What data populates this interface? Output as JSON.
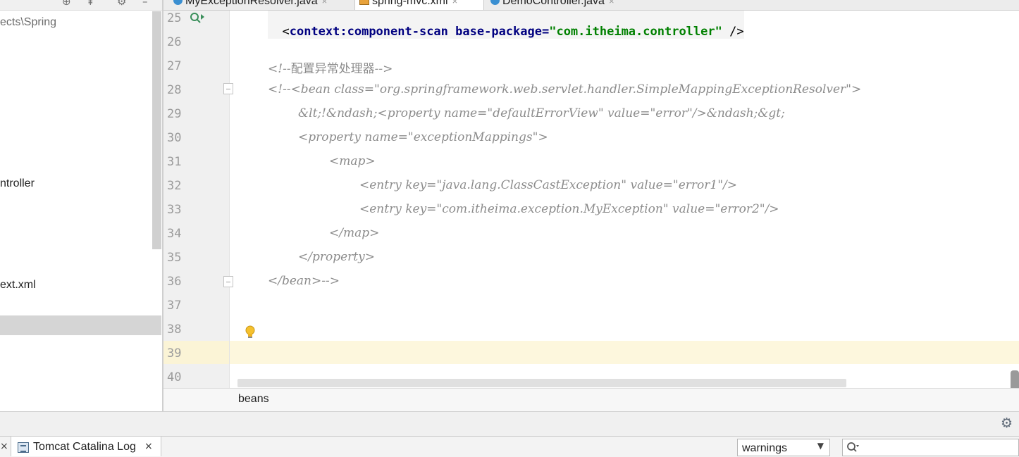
{
  "project": {
    "items": [
      {
        "label": "ects\\Spring"
      },
      {
        "label": "ntroller"
      },
      {
        "label": "ext.xml"
      }
    ]
  },
  "tabs": [
    {
      "label": "MyExceptionResolver.java",
      "icon": "class-c-icon"
    },
    {
      "label": "spring-mvc.xml",
      "icon": "xml-file-icon",
      "active": true
    },
    {
      "label": "DemoController.java",
      "icon": "class-c-icon"
    }
  ],
  "editor": {
    "lines": [
      {
        "num": "25",
        "text": "<context:component-scan base-package=\"com.itheima.controller\"/>"
      },
      {
        "num": "26",
        "text": ""
      },
      {
        "num": "27",
        "text": "<!--配置异常处理器-->"
      },
      {
        "num": "28",
        "text": "<!--<bean class=\"org.springframework.web.servlet.handler.SimpleMappingExceptionResolver\">"
      },
      {
        "num": "29",
        "text": "&lt;!&ndash;<property name=\"defaultErrorView\" value=\"error\"/>&ndash;&gt;"
      },
      {
        "num": "30",
        "text": "<property name=\"exceptionMappings\">"
      },
      {
        "num": "31",
        "text": "<map>"
      },
      {
        "num": "32",
        "text": "<entry key=\"java.lang.ClassCastException\" value=\"error1\"/>"
      },
      {
        "num": "33",
        "text": "<entry key=\"com.itheima.exception.MyException\" value=\"error2\"/>"
      },
      {
        "num": "34",
        "text": "</map>"
      },
      {
        "num": "35",
        "text": "</property>"
      },
      {
        "num": "36",
        "text": "</bean>-->"
      },
      {
        "num": "37",
        "text": ""
      },
      {
        "num": "38",
        "text": ""
      },
      {
        "num": "39",
        "text": ""
      },
      {
        "num": "40",
        "text": ""
      }
    ],
    "line25": {
      "tag": "context:component-scan",
      "attr": "base-package=",
      "value": "\"com.itheima.controller\"",
      "end": " />"
    },
    "comment_cn_open": "<!--",
    "comment_cn": "配置异常处理器",
    "comment_cn_close": "-->"
  },
  "breadcrumb": {
    "label": "beans"
  },
  "bottom": {
    "tab_label": "Tomcat Catalina Log",
    "prev_close": "×",
    "close": "×",
    "filter_value": "warnings",
    "search_placeholder": ""
  },
  "colors": {
    "tag": "#000080",
    "string": "#008000",
    "comment": "#8c8c8c",
    "current_line": "#fdf7dd"
  }
}
